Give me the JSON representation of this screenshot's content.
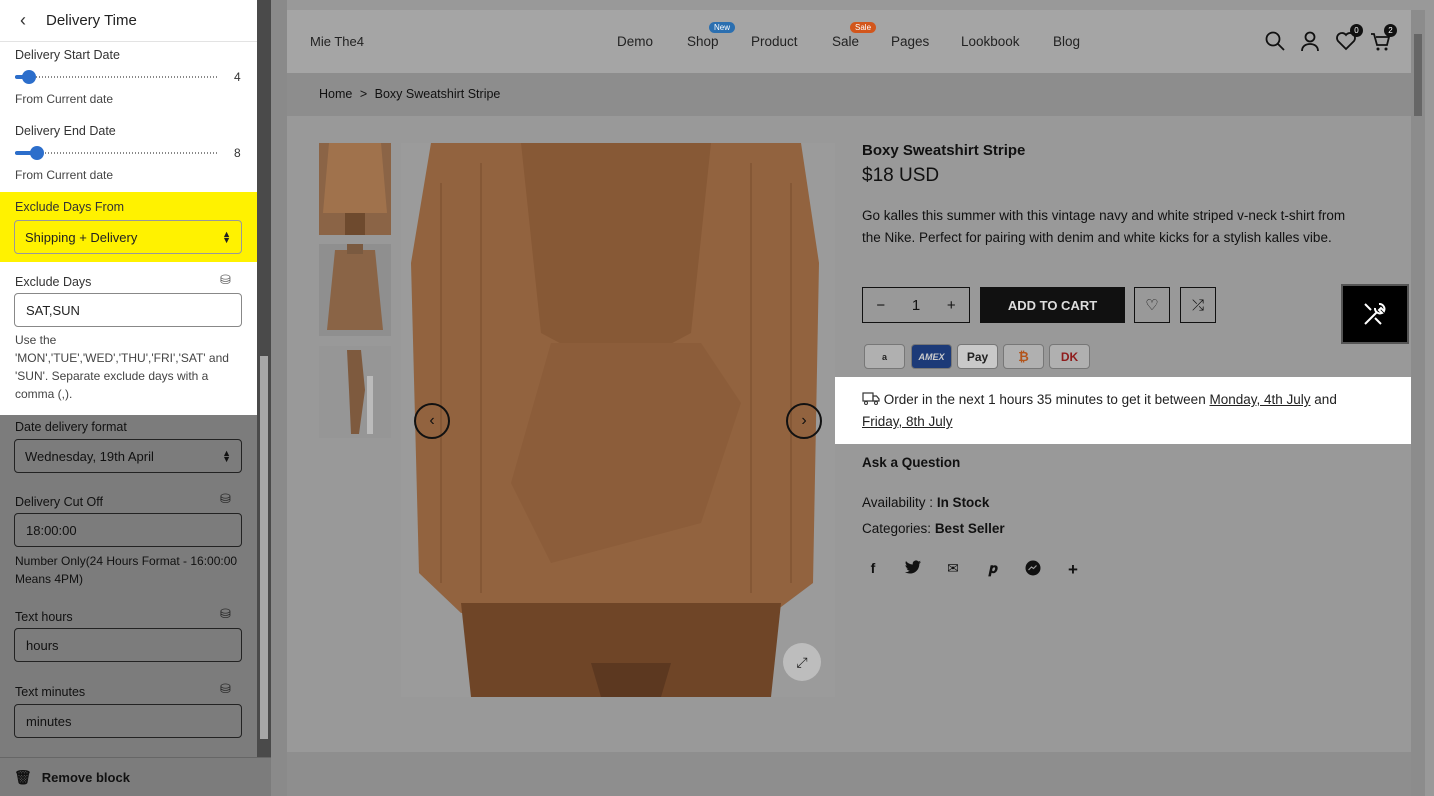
{
  "sidebar": {
    "title": "Delivery Time",
    "start_label": "Delivery Start Date",
    "start_value": "4",
    "start_fraction": 0.07,
    "start_help": "From Current date",
    "end_label": "Delivery End Date",
    "end_value": "8",
    "end_fraction": 0.11,
    "end_help": "From Current date",
    "exclude_from_label": "Exclude Days From",
    "exclude_from_value": "Shipping + Delivery",
    "exclude_days_label": "Exclude Days",
    "exclude_days_value": "SAT,SUN",
    "exclude_days_help": "Use the 'MON','TUE','WED','THU','FRI','SAT' and 'SUN'. Separate exclude days with a comma (,).",
    "date_format_label": "Date delivery format",
    "date_format_value": "Wednesday, 19th April",
    "cutoff_label": "Delivery Cut Off",
    "cutoff_value": "18:00:00",
    "cutoff_help": "Number Only(24 Hours Format - 16:00:00 Means 4PM)",
    "text_hours_label": "Text hours",
    "text_hours_value": "hours",
    "text_minutes_label": "Text minutes",
    "text_minutes_value": "minutes",
    "remove_label": "Remove block"
  },
  "store": {
    "logo": "Mie The4",
    "menu": [
      "Demo",
      "Shop",
      "Product",
      "Sale",
      "Pages",
      "Lookbook",
      "Blog"
    ],
    "shop_badge": "New",
    "sale_badge": "Sale",
    "wishlist_count": "0",
    "cart_count": "2",
    "breadcrumb_home": "Home",
    "breadcrumb_sep": ">",
    "breadcrumb_current": "Boxy Sweatshirt Stripe"
  },
  "product": {
    "title": "Boxy Sweatshirt Stripe",
    "price": "$18 USD",
    "description": "Go kalles this summer with this vintage navy and white striped v-neck t-shirt from the Nike. Perfect for pairing with denim and white kicks for a stylish kalles vibe.",
    "quantity": "1",
    "add_to_cart": "ADD TO CART",
    "payments": [
      "a",
      "AMEX",
      "Pay",
      "₿",
      ""
    ],
    "delivery_prefix": "Order in the next 1 hours 35 minutes to get it between",
    "delivery_start": "Monday, 4th July",
    "delivery_and": "and",
    "delivery_end": "Friday, 8th July",
    "ask_question": "Ask a Question",
    "availability_label": "Availability :",
    "availability_value": "In Stock",
    "categories_label": "Categories:",
    "categories_value": "Best Seller"
  },
  "colors": {
    "highlight": "#fff200",
    "accent_blue": "#2c6ecb",
    "shop_badge": "#2b6fb0",
    "sale_badge": "#d2561c"
  }
}
